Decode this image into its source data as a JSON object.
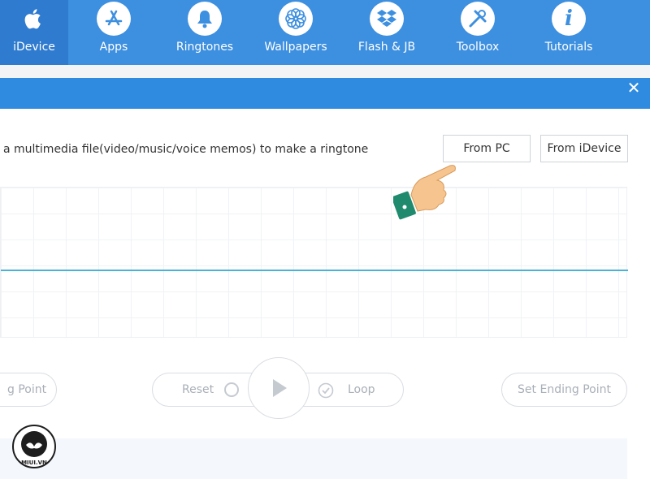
{
  "nav": {
    "items": [
      {
        "label": "iDevice",
        "icon": "apple-icon"
      },
      {
        "label": "Apps",
        "icon": "app-store-icon"
      },
      {
        "label": "Ringtones",
        "icon": "bell-icon"
      },
      {
        "label": "Wallpapers",
        "icon": "flower-icon"
      },
      {
        "label": "Flash & JB",
        "icon": "dropbox-icon"
      },
      {
        "label": "Toolbox",
        "icon": "tools-icon"
      },
      {
        "label": "Tutorials",
        "icon": "info-icon"
      }
    ]
  },
  "dialog": {
    "close": "✕",
    "description": "a multimedia file(video/music/voice memos) to make a ringtone",
    "from_pc": "From PC",
    "from_idevice": "From iDevice"
  },
  "controls": {
    "starting_point": "g Point",
    "reset": "Reset",
    "loop": "Loop",
    "ending_point": "Set Ending Point"
  },
  "watermark": {
    "text": "MIUI.VN"
  },
  "colors": {
    "accent": "#3d8fe0",
    "waveform": "#4db1d6"
  }
}
